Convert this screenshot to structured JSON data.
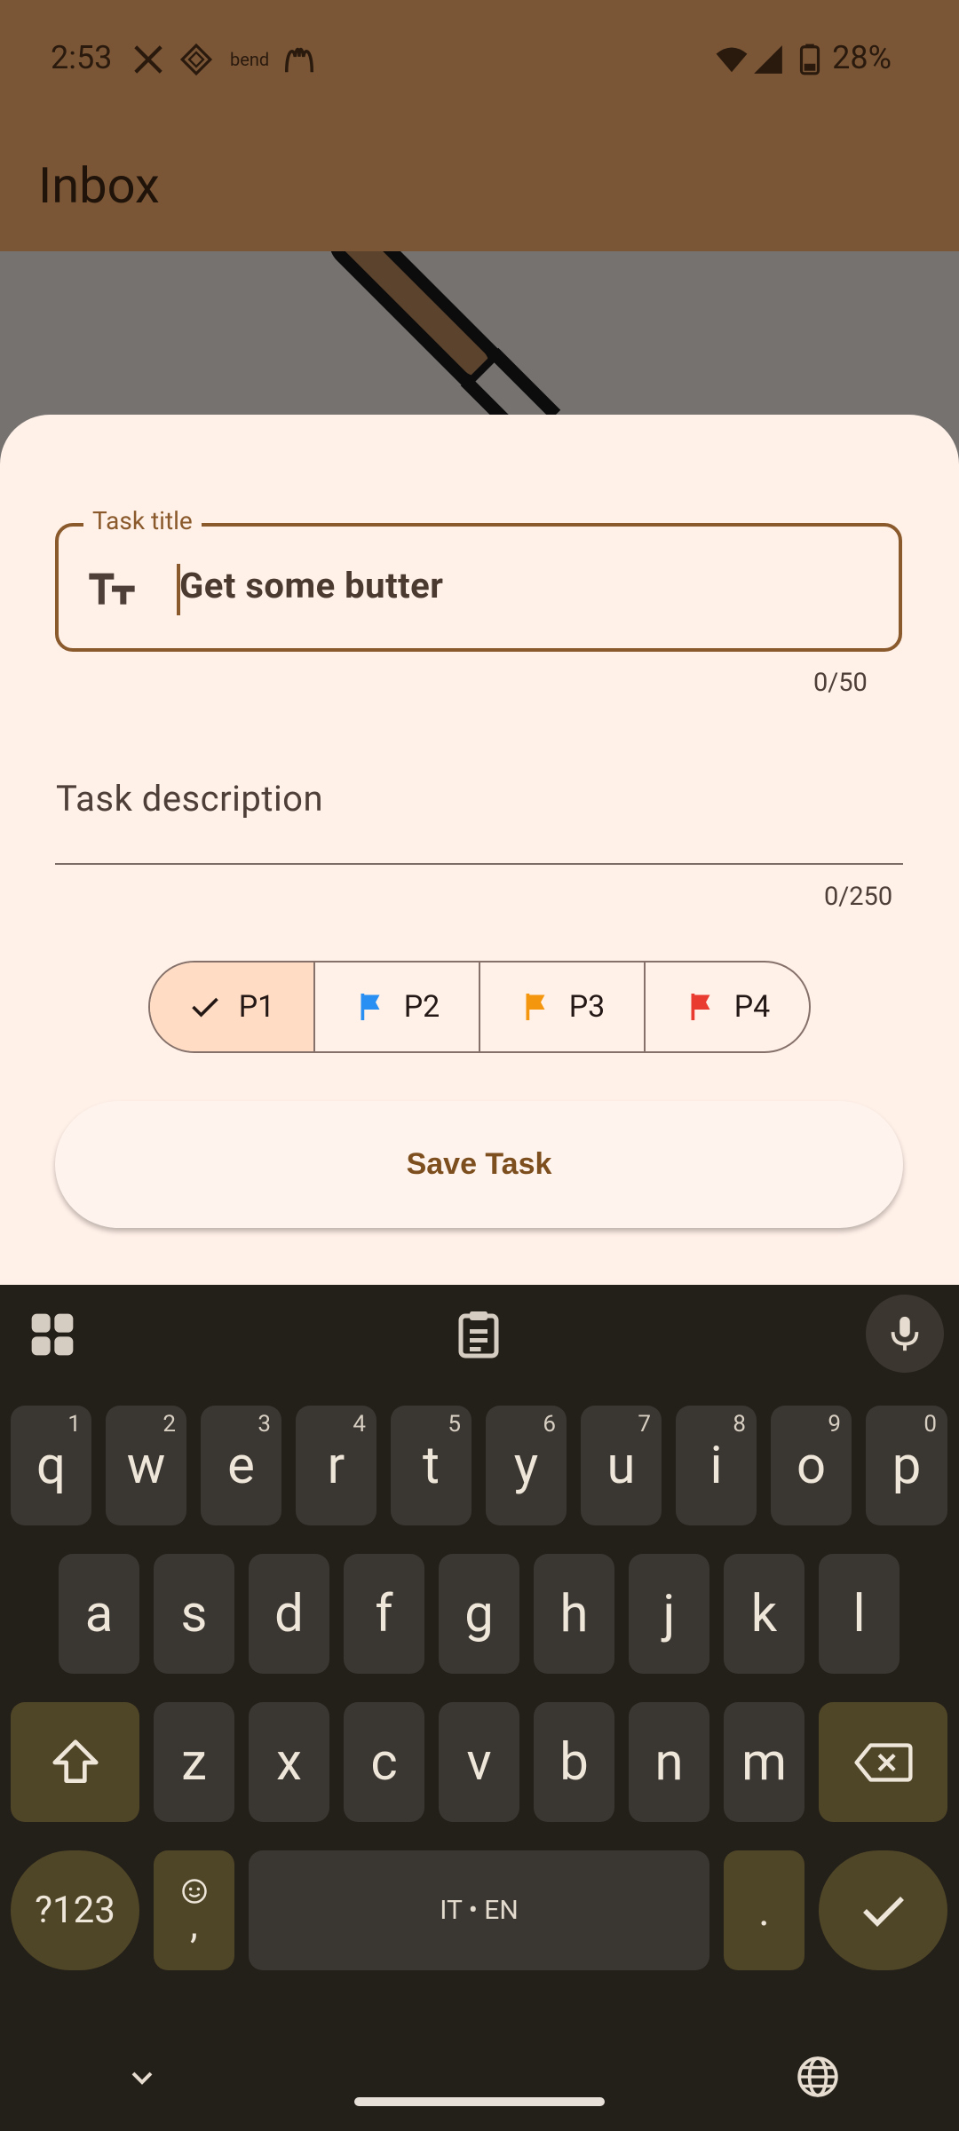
{
  "status_bar": {
    "time": "2:53",
    "battery": "28%",
    "notification_icons": [
      "x-icon",
      "app-diamond-icon",
      "bend-icon",
      "mcdonalds-icon"
    ],
    "bend_text": "bend"
  },
  "app_bar": {
    "title": "Inbox"
  },
  "form": {
    "title_label": "Task title",
    "title_value": "Get some butter",
    "title_counter": "0/50",
    "description_placeholder": "Task description",
    "description_counter": "0/250",
    "priorities": [
      {
        "label": "P1",
        "icon": "check-icon",
        "selected": true,
        "color": "#231815"
      },
      {
        "label": "P2",
        "icon": "flag-icon",
        "selected": false,
        "color": "#2a8ff2"
      },
      {
        "label": "P3",
        "icon": "flag-icon",
        "selected": false,
        "color": "#f5960f"
      },
      {
        "label": "P4",
        "icon": "flag-icon",
        "selected": false,
        "color": "#ea3b30"
      }
    ],
    "save_label": "Save Task"
  },
  "keyboard": {
    "row1": [
      {
        "k": "q",
        "h": "1"
      },
      {
        "k": "w",
        "h": "2"
      },
      {
        "k": "e",
        "h": "3"
      },
      {
        "k": "r",
        "h": "4"
      },
      {
        "k": "t",
        "h": "5"
      },
      {
        "k": "y",
        "h": "6"
      },
      {
        "k": "u",
        "h": "7"
      },
      {
        "k": "i",
        "h": "8"
      },
      {
        "k": "o",
        "h": "9"
      },
      {
        "k": "p",
        "h": "0"
      }
    ],
    "row2": [
      "a",
      "s",
      "d",
      "f",
      "g",
      "h",
      "j",
      "k",
      "l"
    ],
    "row3": [
      "z",
      "x",
      "c",
      "v",
      "b",
      "n",
      "m"
    ],
    "symbols_label": "?123",
    "comma_label": ",",
    "space_label": "IT • EN",
    "period_label": "."
  },
  "colors": {
    "app_bar": "#7a5636",
    "sheet": "#fff0e8",
    "accent": "#8a5a2c",
    "keyboard": "#231f19"
  }
}
